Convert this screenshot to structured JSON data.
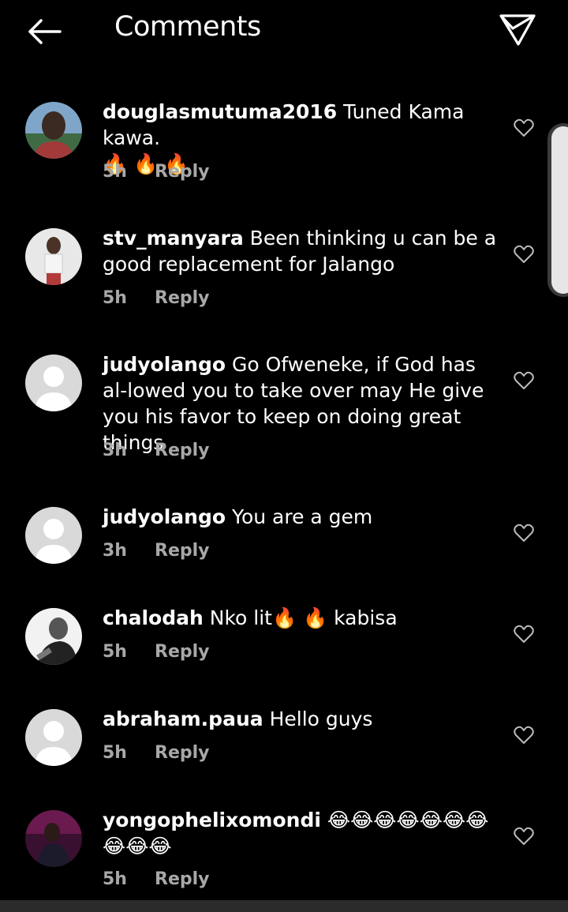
{
  "header": {
    "title": "Comments",
    "back_icon": "back-arrow-icon",
    "share_icon": "paper-plane-icon"
  },
  "comments": [
    {
      "username": "douglasmutuma2016",
      "text": " Tuned Kama kawa.",
      "text_line2": "🔥 🔥 🔥",
      "time": "5h",
      "reply": "Reply",
      "avatar": "photo",
      "like_icon": "heart-outline-icon"
    },
    {
      "username": "stv_manyara",
      "text": " Been thinking u can be a good replacement for Jalango",
      "time": "5h",
      "reply": "Reply",
      "avatar": "photo",
      "like_icon": "heart-outline-icon"
    },
    {
      "username": "judyolango",
      "text": " Go Ofweneke, if God has al-lowed you to take over may He give you his favor to keep on doing great things",
      "time": "3h",
      "reply": "Reply",
      "avatar": "default",
      "like_icon": "heart-outline-icon"
    },
    {
      "username": "judyolango",
      "text": " You are a gem",
      "time": "3h",
      "reply": "Reply",
      "avatar": "default",
      "like_icon": "heart-outline-icon"
    },
    {
      "username": "chalodah",
      "text": " Nko lit🔥 🔥 kabisa",
      "time": "5h",
      "reply": "Reply",
      "avatar": "photo",
      "like_icon": "heart-outline-icon"
    },
    {
      "username": "abraham.paua",
      "text": " Hello guys",
      "time": "5h",
      "reply": "Reply",
      "avatar": "default",
      "like_icon": "heart-outline-icon"
    },
    {
      "username": "yongophelixomondi",
      "text": " 😂😂😂😂😂😂😂😂😂😂",
      "time": "5h",
      "reply": "Reply",
      "avatar": "photo",
      "like_icon": "heart-outline-icon"
    }
  ],
  "colors": {
    "background": "#000000",
    "text": "#ffffff",
    "meta": "#a8a8a8",
    "default_avatar_bg": "#d9d9d9"
  }
}
